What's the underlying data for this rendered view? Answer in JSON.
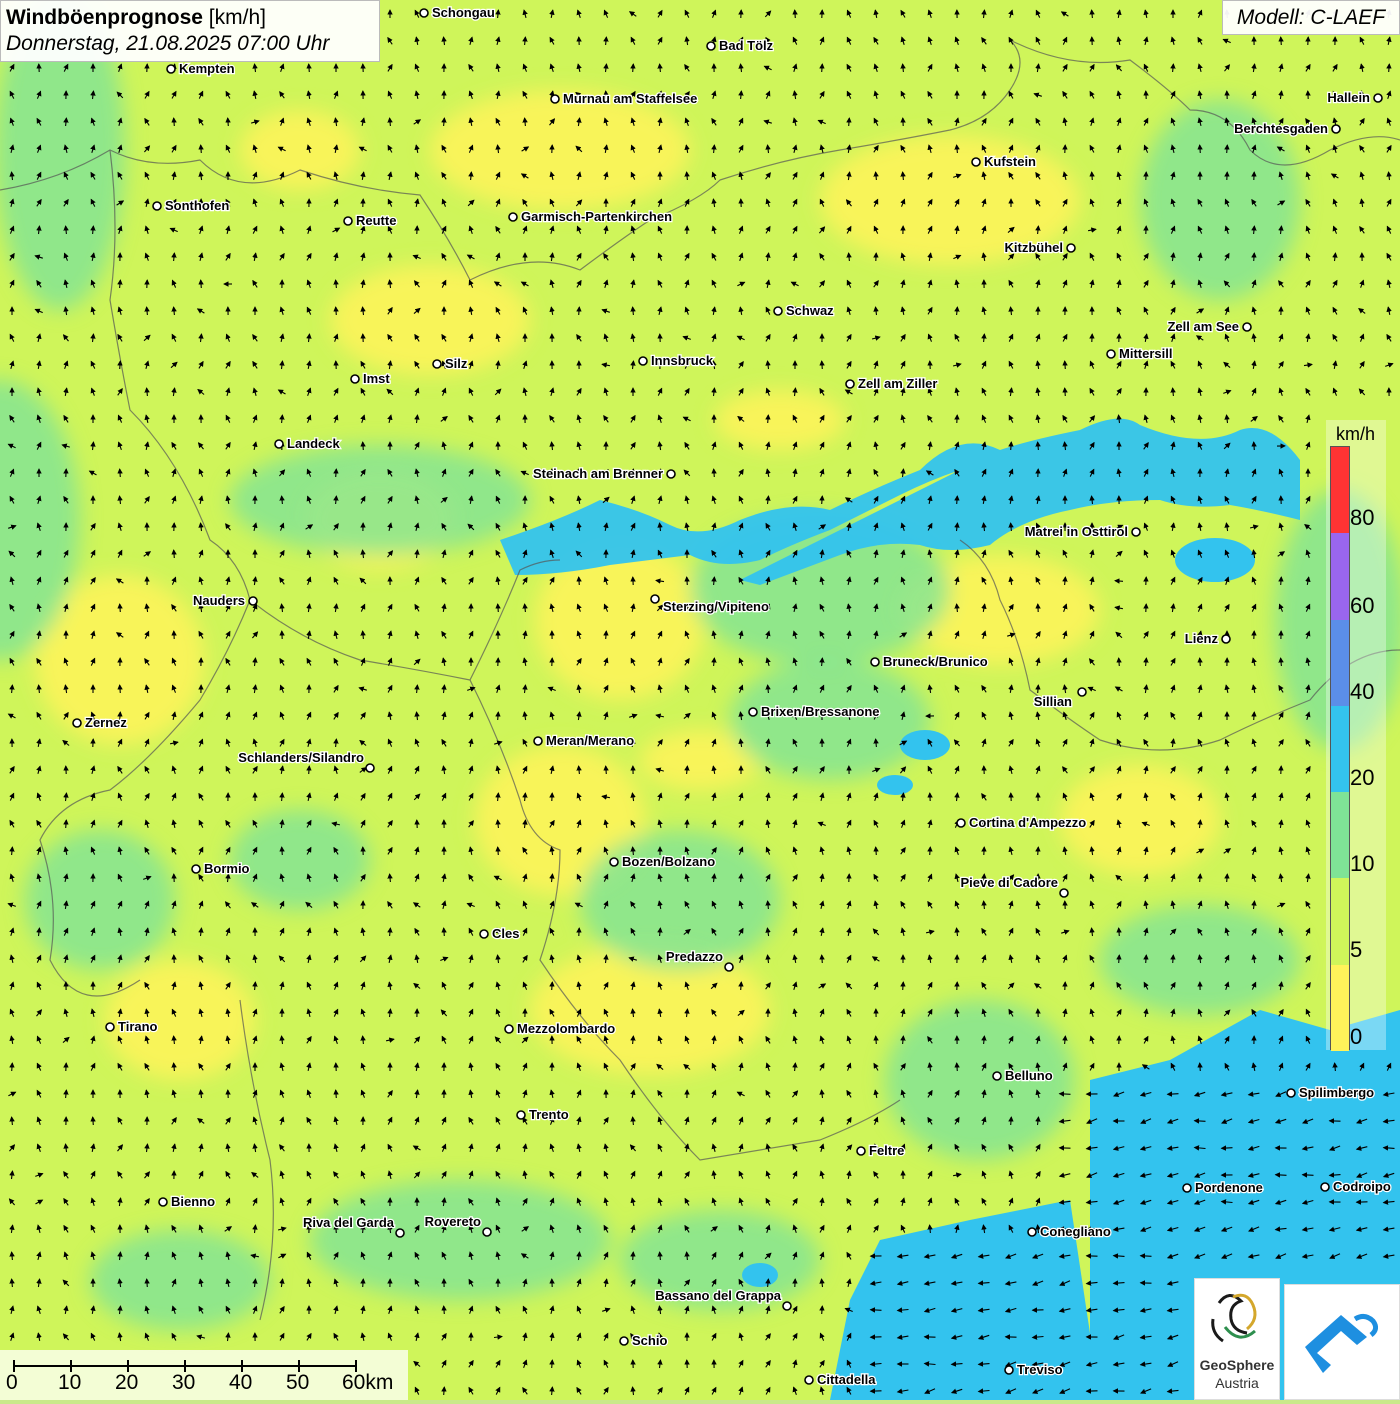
{
  "title": {
    "main": "Windböenprognose",
    "unit": " [km/h]",
    "date": "Donnerstag, 21.08.2025 07:00 Uhr"
  },
  "model": "Modell: C-LAEF",
  "legend": {
    "unit": "km/h",
    "ticks": [
      "80",
      "60",
      "40",
      "20",
      "10",
      "5",
      "0"
    ],
    "colors": [
      "#ff3333",
      "#9966ee",
      "#5b8ee8",
      "#33c3ee",
      "#7fe396",
      "#cff55a",
      "#fff35a"
    ]
  },
  "colors": {
    "calm": "#fff35a",
    "light": "#cff55a",
    "moderate": "#7fe396",
    "breezy": "#33c3ee"
  },
  "scale": {
    "labels": [
      "0",
      "10",
      "20",
      "30",
      "40",
      "50",
      "60km"
    ]
  },
  "logo": {
    "line1": "GeoSphere",
    "line2": "Austria"
  },
  "cities": [
    {
      "name": "Schongau"
    },
    {
      "name": "Bad Tölz"
    },
    {
      "name": "Kempten"
    },
    {
      "name": "Murnau am Staffelsee"
    },
    {
      "name": "Hallein"
    },
    {
      "name": "Berchtesgaden"
    },
    {
      "name": "Kufstein"
    },
    {
      "name": "Sonthofen"
    },
    {
      "name": "Reutte"
    },
    {
      "name": "Garmisch-Partenkirchen"
    },
    {
      "name": "Kitzbühel"
    },
    {
      "name": "Schwaz"
    },
    {
      "name": "Zell am See"
    },
    {
      "name": "Mittersill"
    },
    {
      "name": "Imst"
    },
    {
      "name": "Silz"
    },
    {
      "name": "Innsbruck"
    },
    {
      "name": "Zell am Ziller"
    },
    {
      "name": "Landeck"
    },
    {
      "name": "Steinach am Brenner"
    },
    {
      "name": "Matrei in Osttirol"
    },
    {
      "name": "Nauders"
    },
    {
      "name": "Sterzing/Vipiteno"
    },
    {
      "name": "Lienz"
    },
    {
      "name": "Bruneck/Brunico"
    },
    {
      "name": "Sillian"
    },
    {
      "name": "Zernez"
    },
    {
      "name": "Brixen/Bressanone"
    },
    {
      "name": "Meran/Merano"
    },
    {
      "name": "Schlanders/Silandro"
    },
    {
      "name": "Cortina d'Ampezzo"
    },
    {
      "name": "Bozen/Bolzano"
    },
    {
      "name": "Bormio"
    },
    {
      "name": "Pieve di Cadore"
    },
    {
      "name": "Cles"
    },
    {
      "name": "Predazzo"
    },
    {
      "name": "Tirano"
    },
    {
      "name": "Mezzolombardo"
    },
    {
      "name": "Belluno"
    },
    {
      "name": "Spilimbergo"
    },
    {
      "name": "Trento"
    },
    {
      "name": "Feltre"
    },
    {
      "name": "Pordenone"
    },
    {
      "name": "Codroipo"
    },
    {
      "name": "Bienno"
    },
    {
      "name": "Riva del Garda"
    },
    {
      "name": "Rovereto"
    },
    {
      "name": "Conegliano"
    },
    {
      "name": "Bassano del Grappa"
    },
    {
      "name": "Schio"
    },
    {
      "name": "Treviso"
    },
    {
      "name": "Cittadella"
    }
  ]
}
